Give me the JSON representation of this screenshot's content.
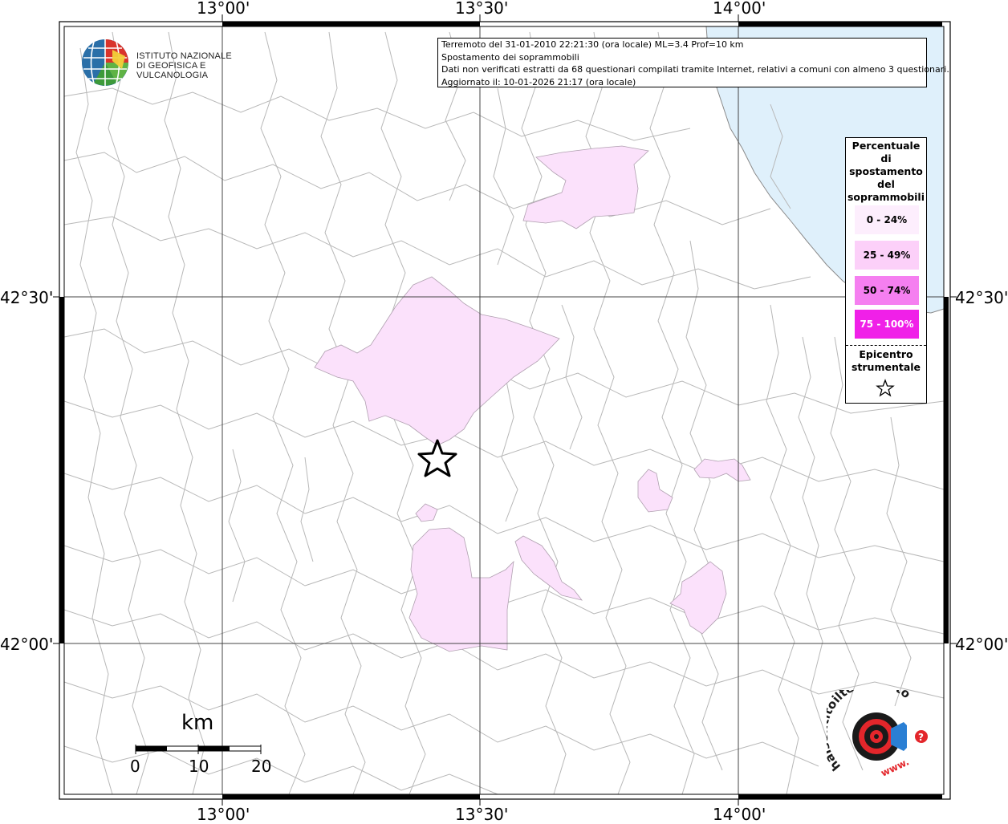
{
  "map": {
    "lon_labels": [
      "13°00'",
      "13°30'",
      "14°00'"
    ],
    "lat_labels": [
      "42°30'",
      "42°00'"
    ],
    "sea_color": "#dff0fb",
    "grid_color": "#333333",
    "boundary_color": "#b4b4b4"
  },
  "info": {
    "line1": "Terremoto del 31-01-2010 22:21:30 (ora locale) ML=3.4 Prof=10 km",
    "line2": "Spostamento dei soprammobili",
    "line3": "Dati non verificati estratti da 68 questionari compilati tramite Internet, relativi a comuni con almeno 3 questionari.",
    "line4": "Aggiornato il: 10-01-2026 21:17 (ora locale)"
  },
  "ingv": {
    "line1": "ISTITUTO NAZIONALE",
    "line2": "DI GEOFISICA E VULCANOLOGIA"
  },
  "legend": {
    "title": "Percentuale di spostamento del soprammobili",
    "items": [
      {
        "label": "0 - 24%",
        "color": "#fdeefd"
      },
      {
        "label": "25 - 49%",
        "color": "#fcd0f9"
      },
      {
        "label": "50 - 74%",
        "color": "#f57ff0"
      },
      {
        "label": "75 - 100%",
        "color": "#f020e8"
      }
    ],
    "epicenter_label": "Epicentro strumentale"
  },
  "scale": {
    "unit": "km",
    "labels": [
      "0",
      "10",
      "20"
    ]
  },
  "hst_logo": {
    "text_main": "haisentitoilterremoto.it",
    "text_sub": "www."
  },
  "areas_color": "#fbe1fb"
}
